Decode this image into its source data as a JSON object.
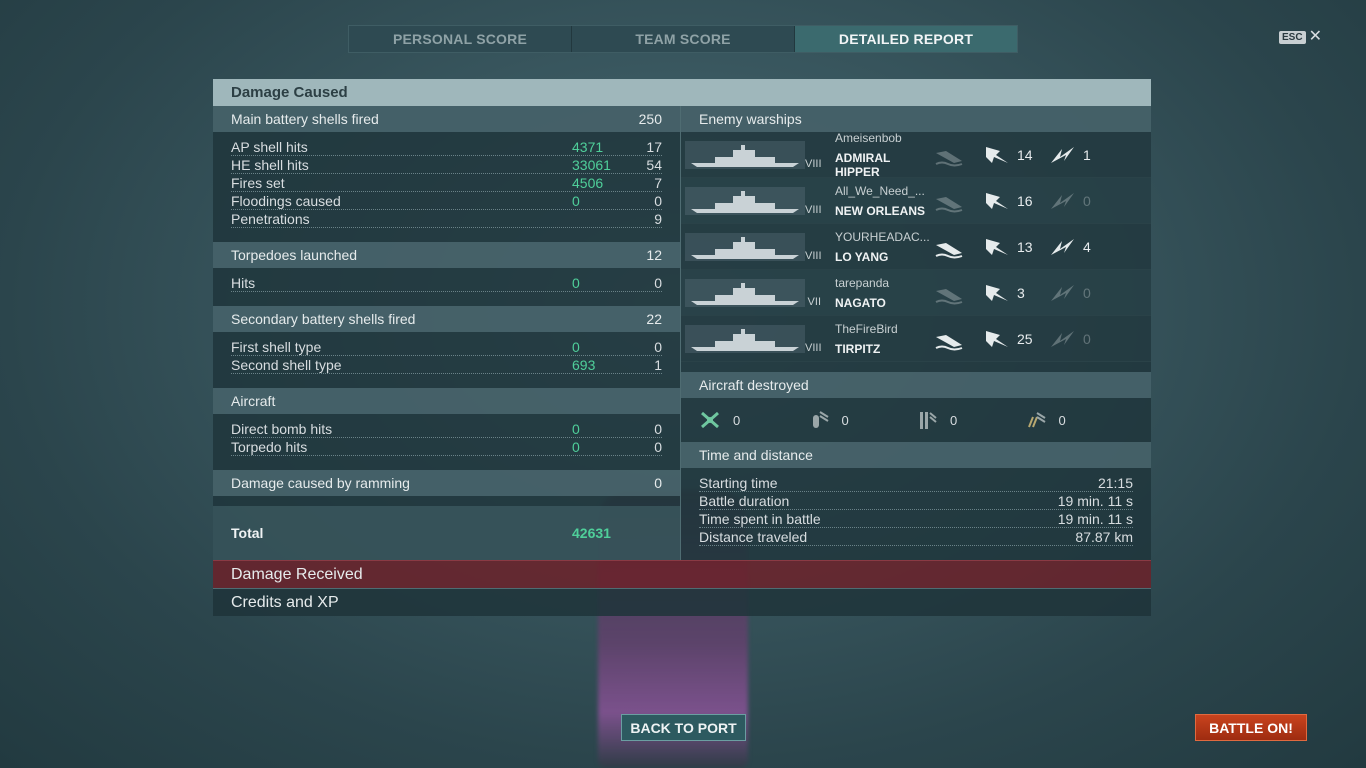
{
  "tabs": [
    {
      "label": "PERSONAL SCORE"
    },
    {
      "label": "TEAM SCORE"
    },
    {
      "label": "DETAILED REPORT"
    }
  ],
  "esc": {
    "key": "ESC",
    "close": "✕"
  },
  "damage_caused": {
    "title": "Damage Caused",
    "main_battery": {
      "label": "Main battery shells fired",
      "count": "250",
      "rows": [
        {
          "label": "AP shell hits",
          "damage": "4371",
          "count": "17"
        },
        {
          "label": "HE shell hits",
          "damage": "33061",
          "count": "54"
        },
        {
          "label": "Fires set",
          "damage": "4506",
          "count": "7"
        },
        {
          "label": "Floodings caused",
          "damage": "0",
          "count": "0"
        },
        {
          "label": "Penetrations",
          "damage": "",
          "count": "9"
        }
      ]
    },
    "torpedoes": {
      "label": "Torpedoes launched",
      "count": "12",
      "rows": [
        {
          "label": "Hits",
          "damage": "0",
          "count": "0"
        }
      ]
    },
    "secondary": {
      "label": "Secondary battery shells fired",
      "count": "22",
      "rows": [
        {
          "label": "First shell type",
          "damage": "0",
          "count": "0"
        },
        {
          "label": "Second shell type",
          "damage": "693",
          "count": "1"
        }
      ]
    },
    "aircraft": {
      "label": "Aircraft",
      "rows": [
        {
          "label": "Direct bomb hits",
          "damage": "0",
          "count": "0"
        },
        {
          "label": "Torpedo hits",
          "damage": "0",
          "count": "0"
        }
      ]
    },
    "ramming": {
      "label": "Damage caused by ramming",
      "count": "0"
    },
    "total": {
      "label": "Total",
      "damage": "42631"
    }
  },
  "enemy_warships": {
    "label": "Enemy warships",
    "rows": [
      {
        "player": "Ameisenbob",
        "ship": "ADMIRAL HIPPER",
        "tier": "VIII",
        "hits": "14",
        "crits": "1",
        "destroyed": false,
        "crits_active": true
      },
      {
        "player": "All_We_Need_...",
        "ship": "NEW ORLEANS",
        "tier": "VIII",
        "hits": "16",
        "crits": "0",
        "destroyed": false,
        "crits_active": false
      },
      {
        "player": "YOURHEADAC...",
        "ship": "LO YANG",
        "tier": "VIII",
        "hits": "13",
        "crits": "4",
        "destroyed": true,
        "crits_active": true
      },
      {
        "player": "tarepanda",
        "ship": "NAGATO",
        "tier": "VII",
        "hits": "3",
        "crits": "0",
        "destroyed": false,
        "crits_active": false
      },
      {
        "player": "TheFireBird",
        "ship": "TIRPITZ",
        "tier": "VIII",
        "hits": "25",
        "crits": "0",
        "destroyed": true,
        "crits_active": false
      }
    ]
  },
  "aircraft_destroyed": {
    "label": "Aircraft destroyed",
    "items": [
      {
        "icon": "fighter-icon",
        "value": "0"
      },
      {
        "icon": "bomber-icon",
        "value": "0"
      },
      {
        "icon": "torpedo-bomber-icon",
        "value": "0"
      },
      {
        "icon": "dive-bomber-icon",
        "value": "0"
      }
    ]
  },
  "time_distance": {
    "label": "Time and distance",
    "rows": [
      {
        "label": "Starting time",
        "value": "21:15"
      },
      {
        "label": "Battle duration",
        "value": "19 min. 11 s"
      },
      {
        "label": "Time spent in battle",
        "value": "19 min. 11 s"
      },
      {
        "label": "Distance traveled",
        "value": "87.87 km"
      }
    ]
  },
  "damage_received": {
    "label": "Damage Received"
  },
  "credits_xp": {
    "label": "Credits and XP"
  },
  "buttons": {
    "back_to_port": "BACK TO PORT",
    "battle_on": "BATTLE ON!"
  },
  "colors": {
    "damage_green": "#4fcf9a",
    "battle_orange": "#c9431e",
    "received_red": "#6e2028"
  }
}
